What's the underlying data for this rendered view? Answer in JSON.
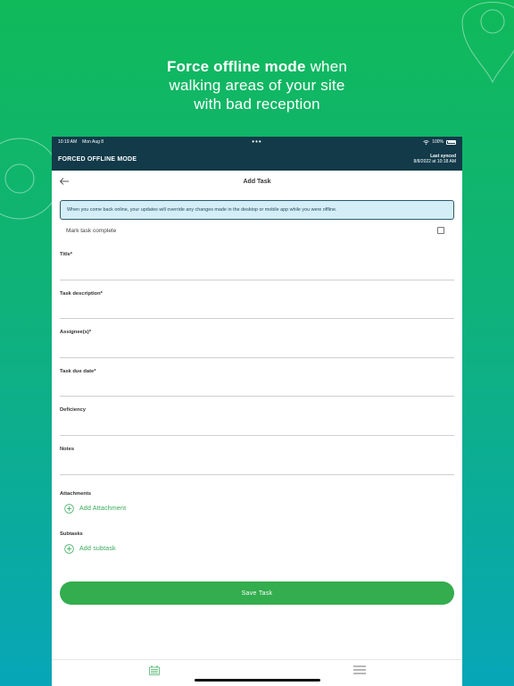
{
  "marketing": {
    "headline_bold": "Force offline mode",
    "headline_rest_1": " when",
    "headline_line2": "walking areas of your site",
    "headline_line3": "with bad reception"
  },
  "status_bar": {
    "time": "10:19 AM",
    "date": "Mon Aug 8",
    "dots": "•••",
    "battery": "100%"
  },
  "app_bar": {
    "mode_title": "FORCED OFFLINE MODE",
    "sync_label": "Last synced",
    "sync_time": "8/8/2022 at 10:18 AM"
  },
  "nav": {
    "title": "Add Task"
  },
  "banner": {
    "message": "When you come back online, your updates will override any changes made in the desktop or mobile app while you were offline."
  },
  "form": {
    "mark_complete": "Mark task complete",
    "fields": [
      {
        "label": "Title*"
      },
      {
        "label": "Task description*"
      },
      {
        "label": "Assignee(s)*"
      },
      {
        "label": "Task due date*"
      },
      {
        "label": "Deficiency"
      },
      {
        "label": "Notes"
      }
    ],
    "attachments_title": "Attachments",
    "add_attachment": "Add Attachment",
    "subtasks_title": "Subtasks",
    "add_subtask": "Add subtask",
    "save_label": "Save Task"
  },
  "colors": {
    "brand_green": "#33ad4d",
    "header_navy": "#123a49",
    "banner_bg": "#d4eef7"
  },
  "icons": {
    "back": "arrow-left-icon",
    "plus": "plus-circle-icon",
    "tasks_tab": "clipboard-icon",
    "menu_tab": "hamburger-menu-icon"
  }
}
